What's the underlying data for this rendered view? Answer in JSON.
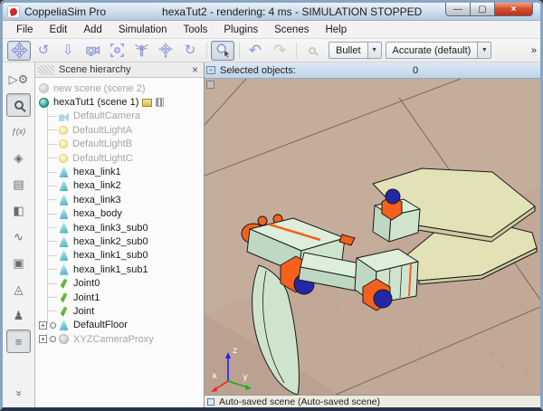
{
  "window": {
    "app_name": "CoppeliaSim Pro",
    "title": "hexaTut2 - rendering: 4 ms - SIMULATION STOPPED",
    "controls": {
      "min": "—",
      "max": "▢",
      "close": "×"
    }
  },
  "menu": {
    "items": [
      "File",
      "Edit",
      "Add",
      "Simulation",
      "Tools",
      "Plugins",
      "Scenes",
      "Help"
    ]
  },
  "toolbar": {
    "buttons": [
      {
        "name": "camera-pan-button",
        "icon": "pan-icon",
        "active": true
      },
      {
        "name": "camera-rotate-button",
        "icon": "rotate-icon"
      },
      {
        "name": "camera-zoom-button",
        "icon": "zoom-icon"
      },
      {
        "name": "camera-angle-button",
        "icon": "camera-icon"
      },
      {
        "name": "fit-to-view-button",
        "icon": "fit-view-icon"
      },
      {
        "name": "fly-mode-button",
        "icon": "dragonfly-icon"
      },
      {
        "name": "object-shift-button",
        "icon": "object-shift-icon"
      },
      {
        "name": "object-rotate-button",
        "icon": "object-rotate-icon"
      },
      {
        "name": "select-button",
        "icon": "select-icon",
        "active": true
      },
      {
        "name": "undo-button",
        "icon": "undo-icon"
      },
      {
        "name": "redo-button",
        "icon": "redo-icon",
        "enabled": false
      },
      {
        "name": "visualize-dynamics-button",
        "icon": "magnifier-icon",
        "enabled": false
      }
    ],
    "glyphs": {
      "rotate": "↺",
      "zoom": "⇩",
      "object_rotate": "↻",
      "undo": "↶",
      "redo": "↷",
      "dropdown": "▼"
    },
    "engine": {
      "label": "Bullet"
    },
    "accuracy": {
      "label": "Accurate (default)"
    },
    "overflow": "»"
  },
  "sidebar": {
    "items": [
      {
        "name": "simulation-settings-button",
        "icon": "play-gear-icon",
        "glyph": "▷⚙"
      },
      {
        "name": "object-properties-button",
        "icon": "magnifier-cube-icon",
        "glyph": "",
        "cls": "mag",
        "active": true
      },
      {
        "name": "calculation-modules-button",
        "icon": "fx-icon",
        "glyph": "ƒ(x)",
        "cls": "small"
      },
      {
        "name": "collections-button",
        "icon": "collection-icon",
        "glyph": "◈"
      },
      {
        "name": "scripts-button",
        "icon": "script-icon",
        "glyph": "▤"
      },
      {
        "name": "shape-edit-button",
        "icon": "shape-edit-icon",
        "glyph": "◧"
      },
      {
        "name": "path-edit-button",
        "icon": "path-edit-icon",
        "glyph": "∿"
      },
      {
        "name": "selection-button",
        "icon": "selection-window-icon",
        "glyph": "▣"
      },
      {
        "name": "model-browser-button",
        "icon": "shapes-icon",
        "glyph": "◬"
      },
      {
        "name": "avatar-button",
        "icon": "robot-icon",
        "glyph": "♟"
      },
      {
        "name": "layer-selector-button",
        "icon": "layers-icon",
        "glyph": "≡",
        "active": true
      },
      {
        "name": "collapse-button",
        "icon": "chevrons-down-icon",
        "glyph": "»",
        "cls": "rot90",
        "spacer_before": true
      }
    ]
  },
  "hierarchy": {
    "header_title": "Scene hierarchy",
    "close_glyph": "×",
    "expand_glyph": "+",
    "tree": [
      {
        "label": "new scene (scene 2)",
        "icon": "scene-icon",
        "level": 0,
        "gray": true
      },
      {
        "label": "hexaTut1 (scene 1)",
        "icon": "scene-icon",
        "level": 0,
        "badges": true
      },
      {
        "label": "DefaultCamera",
        "icon": "camera-icon",
        "level": 1,
        "gray": true
      },
      {
        "label": "DefaultLightA",
        "icon": "light-icon",
        "level": 1,
        "gray": true
      },
      {
        "label": "DefaultLightB",
        "icon": "light-icon",
        "level": 1,
        "gray": true
      },
      {
        "label": "DefaultLightC",
        "icon": "light-icon",
        "level": 1,
        "gray": true
      },
      {
        "label": "hexa_link1",
        "icon": "shape-icon",
        "level": 1
      },
      {
        "label": "hexa_link2",
        "icon": "shape-icon",
        "level": 1
      },
      {
        "label": "hexa_link3",
        "icon": "shape-icon",
        "level": 1
      },
      {
        "label": "hexa_body",
        "icon": "shape-icon",
        "level": 1
      },
      {
        "label": "hexa_link3_sub0",
        "icon": "shape-icon",
        "level": 1
      },
      {
        "label": "hexa_link2_sub0",
        "icon": "shape-icon",
        "level": 1
      },
      {
        "label": "hexa_link1_sub0",
        "icon": "shape-icon",
        "level": 1
      },
      {
        "label": "hexa_link1_sub1",
        "icon": "shape-icon",
        "level": 1
      },
      {
        "label": "Joint0",
        "icon": "joint-icon",
        "level": 1
      },
      {
        "label": "Joint1",
        "icon": "joint-icon",
        "level": 1
      },
      {
        "label": "Joint",
        "icon": "joint-icon",
        "level": 1
      },
      {
        "label": "DefaultFloor",
        "icon": "shape-icon",
        "level": 1,
        "expandable": true
      },
      {
        "label": "XYZCameraProxy",
        "icon": "proxy-icon",
        "level": 1,
        "gray": true,
        "expandable": true
      }
    ]
  },
  "viewport": {
    "selected_label": "Selected objects:",
    "selected_value": "0",
    "collapse_glyph": "-",
    "status": "Auto-saved scene (Auto-saved scene)",
    "axis": {
      "x": "x",
      "y": "y",
      "z": "z"
    }
  },
  "colors": {
    "floor": "#c1a897",
    "floor_line": "#6e6254",
    "plate": "#e3e2b6",
    "plate_side": "#cbcb9e",
    "robot_top": "#ddeeda",
    "robot_side": "#bed8c2",
    "robot_face": "#cfe4cc",
    "outline": "#1a1a1a",
    "orange": "#f5601d",
    "cap_blue": "#2626a8",
    "axis_x": "#ee2222",
    "axis_y": "#22aa22",
    "axis_z": "#2222ee"
  }
}
